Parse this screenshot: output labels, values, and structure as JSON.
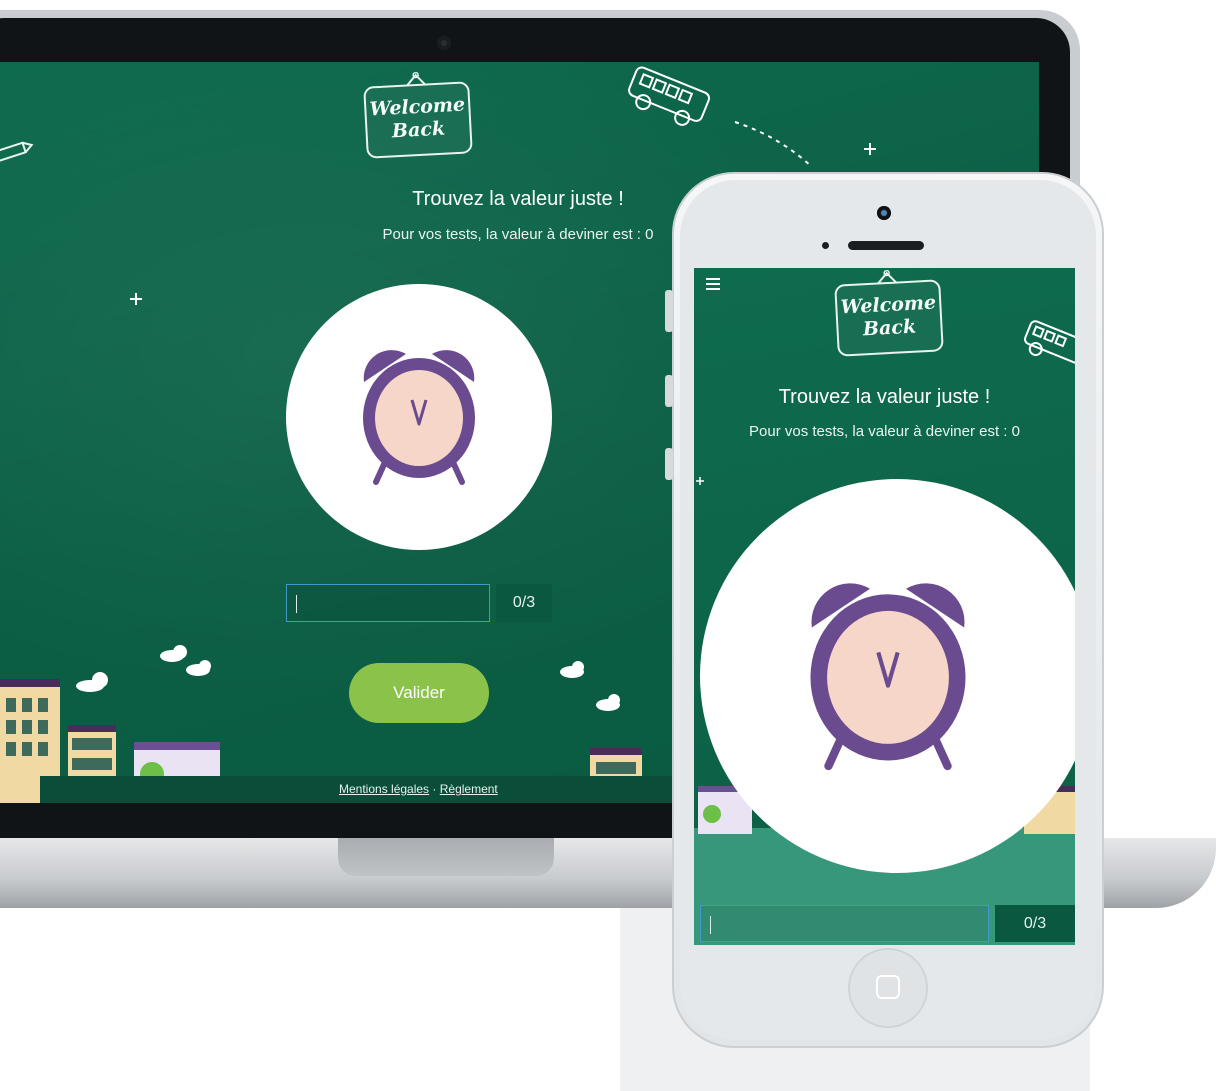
{
  "colors": {
    "board_green": "#0d6649",
    "button_green": "#8bc34a",
    "input_border": "#3f9ac7",
    "clock_purple": "#6b4b8f",
    "clock_face": "#f6d6c8"
  },
  "desktop": {
    "logo_line1": "Welcome",
    "logo_line2": "Back",
    "title": "Trouvez la valeur juste !",
    "subtitle": "Pour vos tests, la valeur à deviner est : 0",
    "input_value": "",
    "counter": "0/3",
    "submit_label": "Valider",
    "footer": {
      "link_legal": "Mentions légales",
      "separator": " · ",
      "link_rules": "Règlement"
    }
  },
  "mobile": {
    "menu_icon": "hamburger-icon",
    "logo_line1": "Welcome",
    "logo_line2": "Back",
    "title": "Trouvez la valeur juste !",
    "subtitle": "Pour vos tests, la valeur à deviner est : 0",
    "input_value": "",
    "counter": "0/3"
  },
  "icons": {
    "central": "alarm-clock-icon",
    "decor_bus": "school-bus-icon",
    "decor_pencil": "pencil-icon",
    "decor_clouds": "cloud-icon",
    "decor_plus": "plus-icon"
  }
}
